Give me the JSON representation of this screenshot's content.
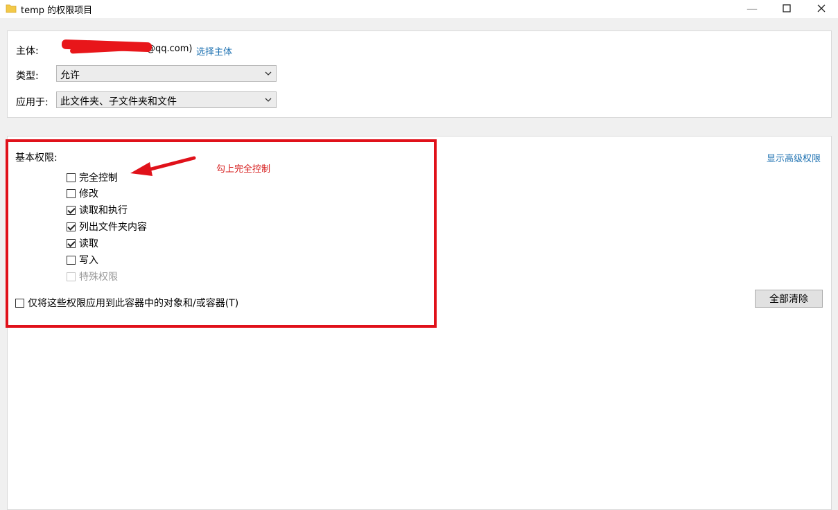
{
  "window": {
    "title": "temp 的权限项目"
  },
  "principal": {
    "label": "主体:",
    "value": "@qq.com)",
    "select_link": "选择主体"
  },
  "type": {
    "label": "类型:",
    "selected": "允许"
  },
  "applies_to": {
    "label": "应用于:",
    "selected": "此文件夹、子文件夹和文件"
  },
  "permissions": {
    "title": "基本权限:",
    "items": [
      {
        "label": "完全控制",
        "checked": false,
        "disabled": false
      },
      {
        "label": "修改",
        "checked": false,
        "disabled": false
      },
      {
        "label": "读取和执行",
        "checked": true,
        "disabled": false
      },
      {
        "label": "列出文件夹内容",
        "checked": true,
        "disabled": false
      },
      {
        "label": "读取",
        "checked": true,
        "disabled": false
      },
      {
        "label": "写入",
        "checked": false,
        "disabled": false
      },
      {
        "label": "特殊权限",
        "checked": false,
        "disabled": true
      }
    ],
    "apply_only_label": "仅将这些权限应用到此容器中的对象和/或容器(T)",
    "apply_only_checked": false
  },
  "annotation": {
    "text": "勾上完全控制",
    "color": "#d61a1a"
  },
  "advanced_link": "显示高级权限",
  "clear_all_button": "全部清除",
  "colors": {
    "link": "#1a6fb0",
    "highlight": "#e0111a"
  }
}
